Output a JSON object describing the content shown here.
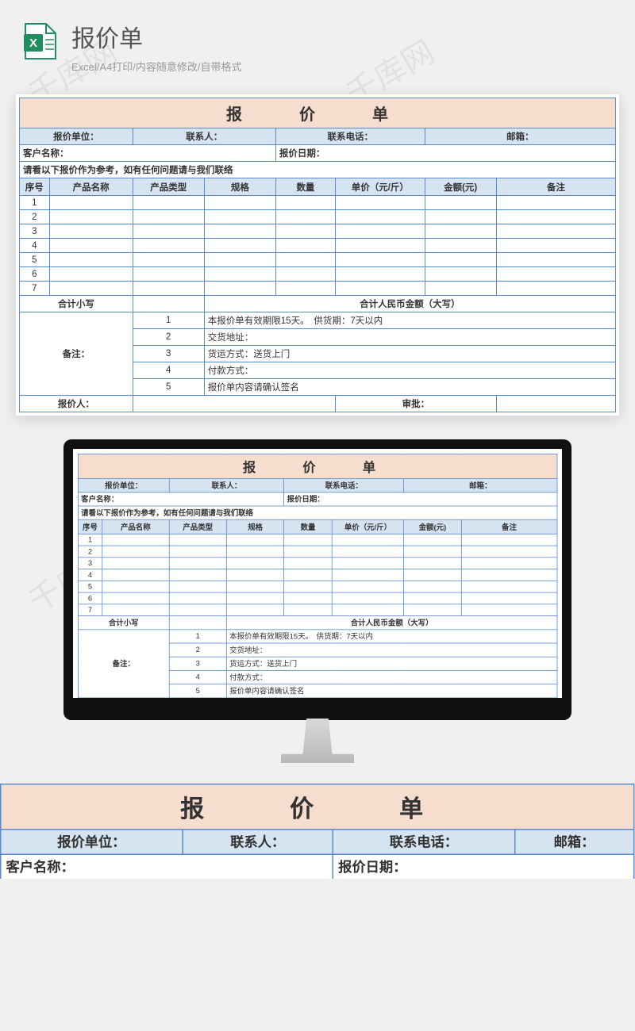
{
  "watermark": "千库网",
  "header": {
    "title": "报价单",
    "subtitle": "Excel/A4打印/内容随意修改/自带格式"
  },
  "sheet": {
    "title": "报　价　单",
    "row2": {
      "quote_unit": "报价单位：",
      "contact": "联系人：",
      "phone": "联系电话：",
      "email": "邮箱："
    },
    "row3": {
      "client": "客户名称：",
      "date": "报价日期："
    },
    "note_line": "请看以下报价作为参考，如有任何问题请与我们联络",
    "cols": [
      "序号",
      "产品名称",
      "产品类型",
      "规格",
      "数量",
      "单价（元/斤）",
      "金额(元)",
      "备注"
    ],
    "rows": [
      "1",
      "2",
      "3",
      "4",
      "5",
      "6",
      "7"
    ],
    "subtotal": {
      "small": "合计小写",
      "big": "合计人民币金额（大写）"
    },
    "remarks_label": "备注：",
    "remarks": [
      {
        "n": "1",
        "t": "本报价单有效期限15天。　供货期：7天以内"
      },
      {
        "n": "2",
        "t": "交货地址："
      },
      {
        "n": "3",
        "t": "货运方式：送货上门"
      },
      {
        "n": "4",
        "t": "付款方式："
      },
      {
        "n": "5",
        "t": "报价单内容请确认签名"
      }
    ],
    "footer": {
      "quoter": "报价人：",
      "approve": "审批："
    }
  }
}
